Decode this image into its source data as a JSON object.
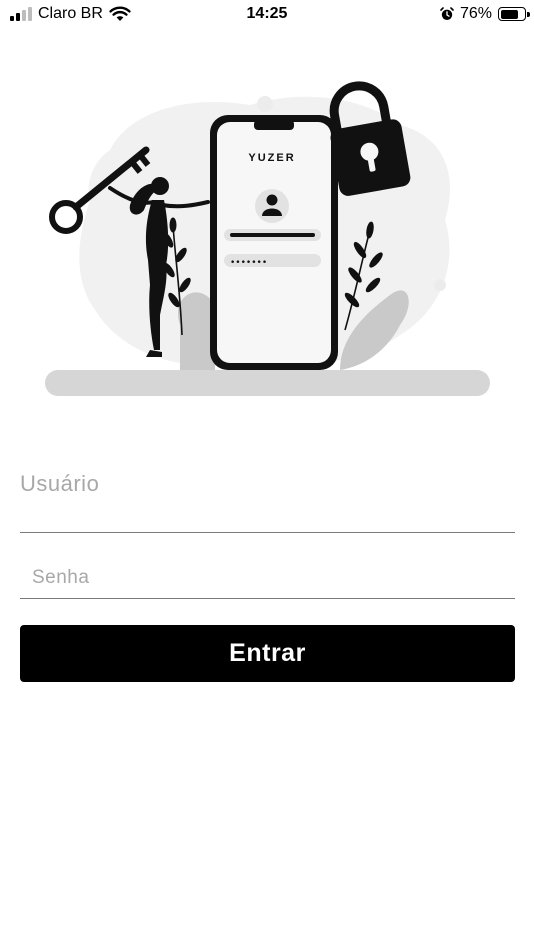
{
  "status_bar": {
    "carrier": "Claro BR",
    "time": "14:25",
    "battery_percent": "76%",
    "battery_level": 0.76,
    "signal_bars_active": 2,
    "signal_bars_total": 4,
    "icons": [
      "signal-icon",
      "wifi-icon",
      "alarm-icon",
      "battery-icon"
    ]
  },
  "illustration": {
    "brand": "YUZER",
    "password_mask": "•••••••"
  },
  "login_form": {
    "username_placeholder": "Usuário",
    "username_value": "",
    "password_placeholder": "Senha",
    "password_value": "",
    "submit_label": "Entrar"
  }
}
